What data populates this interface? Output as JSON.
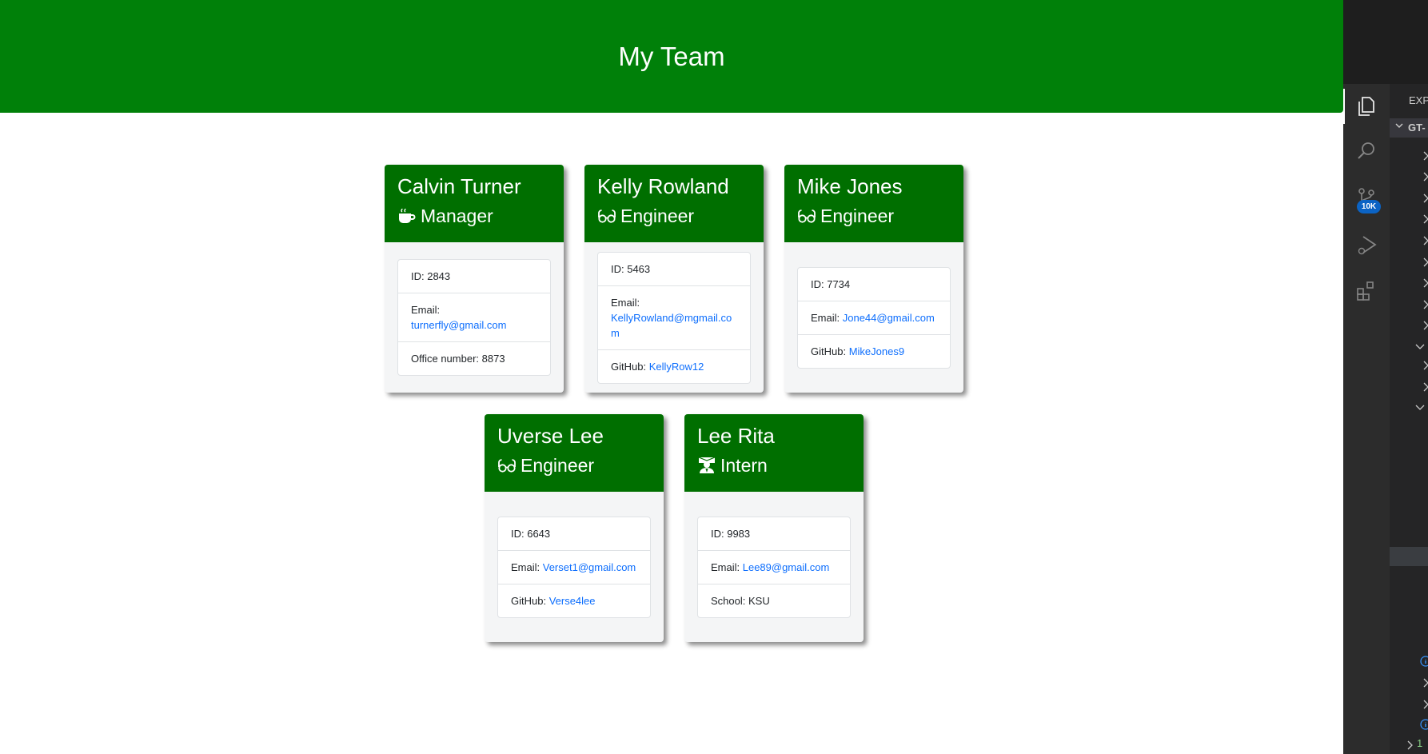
{
  "header": {
    "title": "My Team"
  },
  "cards": [
    {
      "name": "Calvin Turner",
      "role": "Manager",
      "icon": "coffee-icon",
      "id_text": "ID: 2843",
      "email_label": "Email: ",
      "email": "turnerfly@gmail.com",
      "extra_label": "Office number: 8873",
      "extra_link": ""
    },
    {
      "name": "Kelly Rowland",
      "role": "Engineer",
      "icon": "glasses-icon",
      "id_text": "ID: 5463",
      "email_label": "Email: ",
      "email": "KellyRowland@mgmail.com",
      "extra_label": "GitHub: ",
      "extra_link": "KellyRow12"
    },
    {
      "name": "Mike Jones",
      "role": "Engineer",
      "icon": "glasses-icon",
      "id_text": "ID: 7734",
      "email_label": "Email: ",
      "email": "Jone44@gmail.com",
      "extra_label": "GitHub: ",
      "extra_link": "MikeJones9"
    },
    {
      "name": "Uverse Lee",
      "role": "Engineer",
      "icon": "glasses-icon",
      "id_text": "ID: 6643",
      "email_label": "Email: ",
      "email": "Verset1@gmail.com",
      "extra_label": "GitHub: ",
      "extra_link": "Verse4lee"
    },
    {
      "name": "Lee Rita",
      "role": "Intern",
      "icon": "graduate-icon",
      "id_text": "ID: 9983",
      "email_label": "Email: ",
      "email": "Lee89@gmail.com",
      "extra_label": "School: KSU",
      "extra_link": ""
    }
  ],
  "vscode": {
    "explorer_title": "EXP",
    "root_folder": "GT-",
    "scm_badge": "10K",
    "bottom_text": "1",
    "activity_icons": [
      "files-icon",
      "search-icon",
      "source-control-icon",
      "run-debug-icon",
      "extensions-icon"
    ]
  },
  "colors": {
    "header_bg": "#008009",
    "card_header_bg": "#006f00",
    "link": "#0d6efd",
    "card_body_bg": "#f4f5f6"
  }
}
